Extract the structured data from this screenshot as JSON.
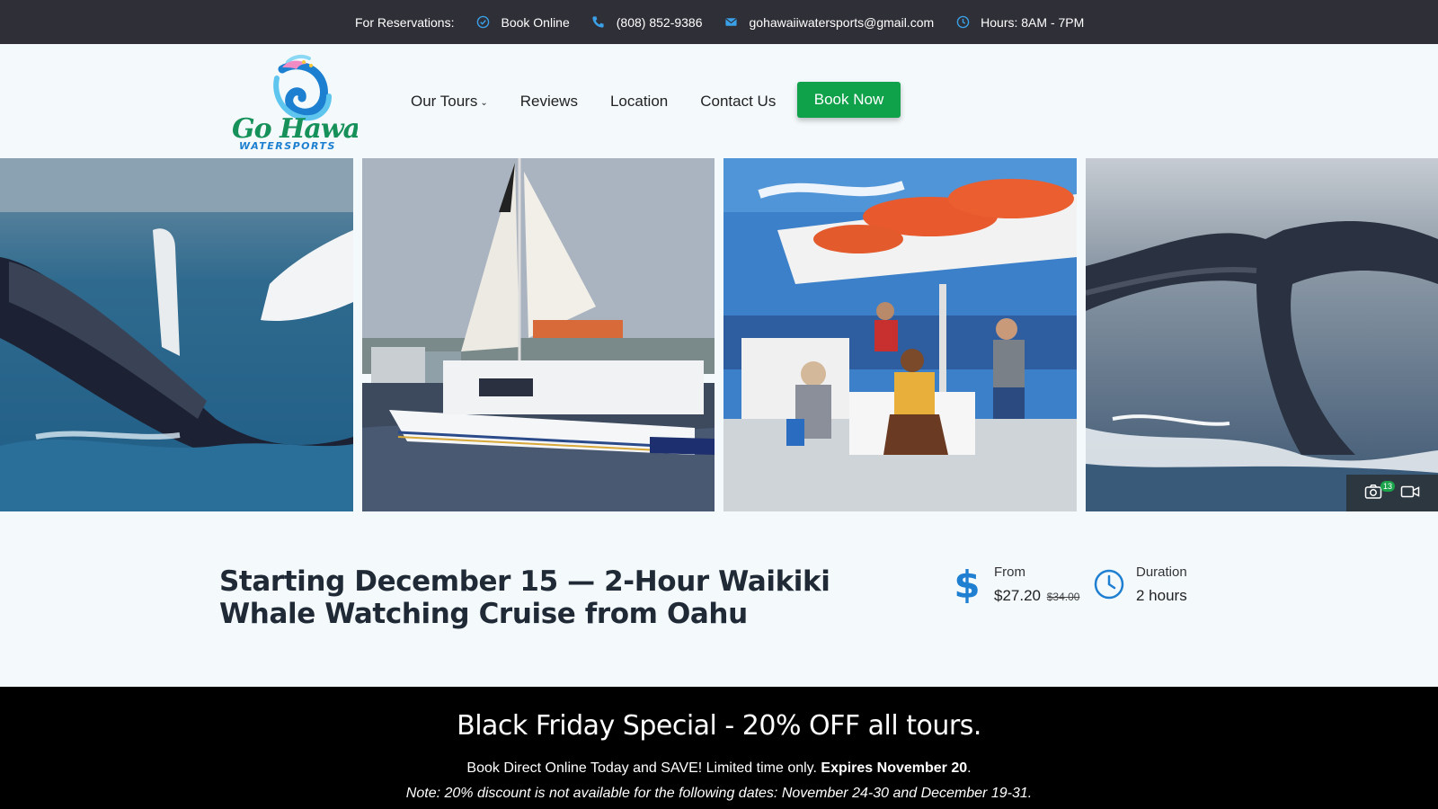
{
  "topbar": {
    "reservations_label": "For Reservations:",
    "book_online": "Book Online",
    "phone": "(808) 852-9386",
    "email": "gohawaiiwatersports@gmail.com",
    "hours": "Hours: 8AM - 7PM",
    "icons": [
      "check-circle-icon",
      "phone-icon",
      "envelope-icon",
      "clock-icon"
    ],
    "icon_color": "#3aa0e8"
  },
  "header": {
    "logo_text": "Go Hawaii",
    "logo_subtext": "WATERSPORTS",
    "nav": [
      {
        "label": "Our Tours",
        "has_dropdown": true
      },
      {
        "label": "Reviews"
      },
      {
        "label": "Location"
      },
      {
        "label": "Contact Us"
      }
    ],
    "book_now": "Book Now",
    "book_now_color": "#0fa24a"
  },
  "gallery": {
    "photos": [
      "humpback whale breaching",
      "white catamaran sailing",
      "passengers on catamaran deck",
      "whale tail fluke"
    ],
    "media_count": "13",
    "media_icons": [
      "camera-icon",
      "video-icon"
    ]
  },
  "tour": {
    "title": "Starting December 15 — 2-Hour Waikiki Whale Watching Cruise from Oahu",
    "price_label": "From",
    "price": "$27.20",
    "old_price": "$34.00",
    "duration_label": "Duration",
    "duration": "2 hours",
    "accent_color": "#1f7fd1"
  },
  "promo": {
    "headline": "Black Friday Special - 20% OFF all tours.",
    "line1_text": "Book Direct Online Today and SAVE! Limited time only.",
    "line1_bold": "Expires November 20",
    "line1_end": ".",
    "note": "Note: 20% discount is not available for the following dates: November 24-30 and December 19-31."
  }
}
